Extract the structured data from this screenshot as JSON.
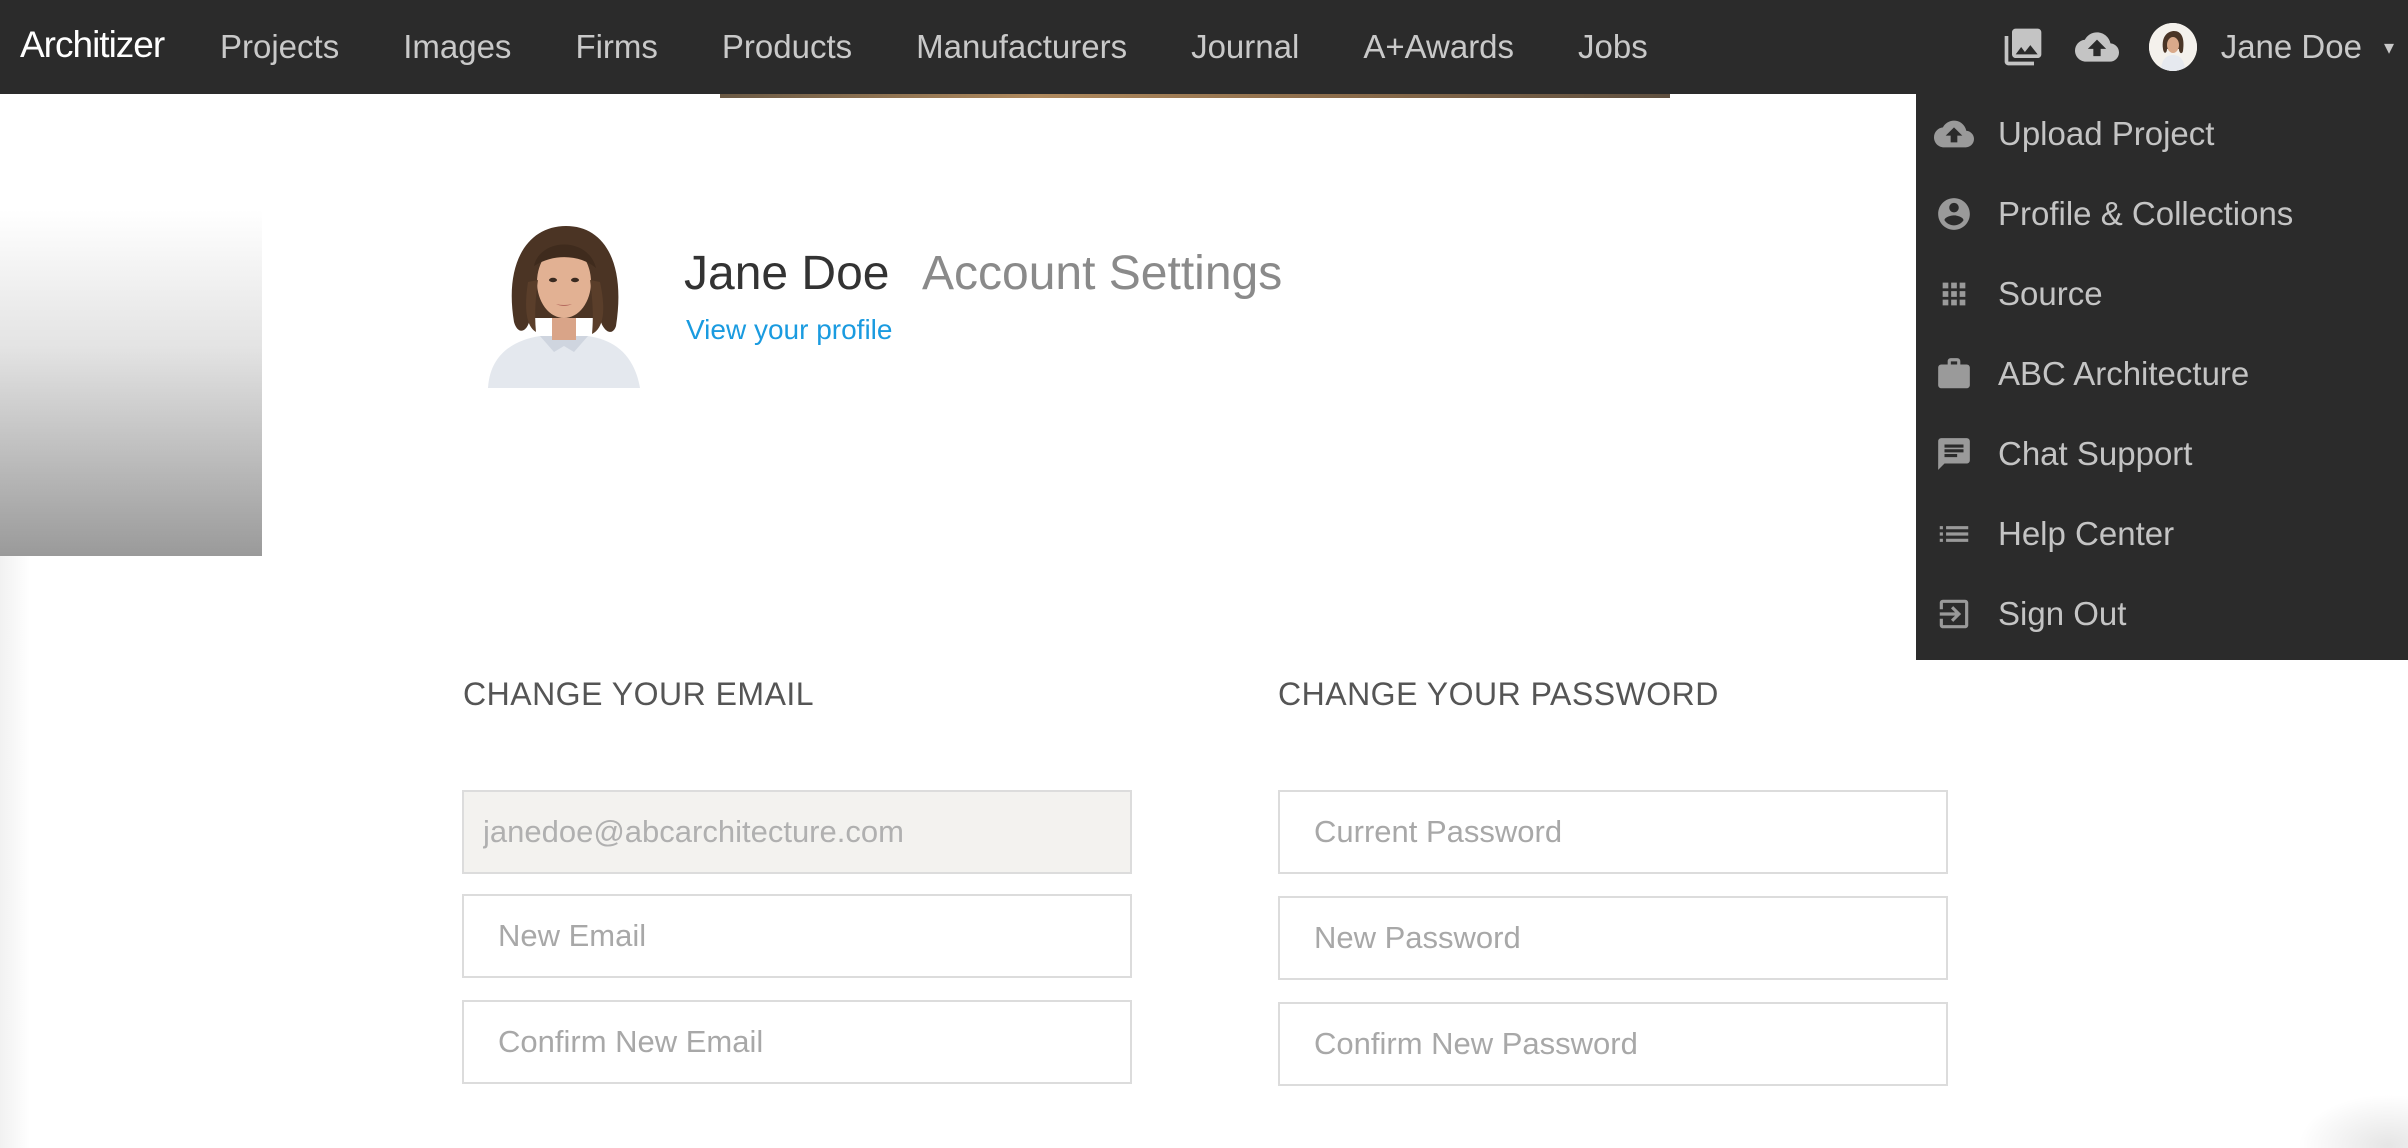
{
  "brand": {
    "logo_text": "Architizer"
  },
  "nav": {
    "items": [
      {
        "label": "Projects"
      },
      {
        "label": "Images"
      },
      {
        "label": "Firms"
      },
      {
        "label": "Products"
      },
      {
        "label": "Manufacturers"
      },
      {
        "label": "Journal"
      },
      {
        "label": "A+Awards"
      },
      {
        "label": "Jobs"
      }
    ]
  },
  "user": {
    "name": "Jane Doe",
    "caret": "▾"
  },
  "profile": {
    "name": "Jane Doe",
    "page_title": "Account Settings",
    "view_profile_link": "View your profile"
  },
  "email_section": {
    "heading": "CHANGE YOUR EMAIL",
    "current_email": "janedoe@abcarchitecture.com",
    "new_email_placeholder": "New Email",
    "confirm_email_placeholder": "Confirm New Email"
  },
  "password_section": {
    "heading": "CHANGE YOUR PASSWORD",
    "current_password_placeholder": "Current Password",
    "new_password_placeholder": "New Password",
    "confirm_password_placeholder": "Confirm New Password"
  },
  "user_menu": {
    "items": [
      {
        "label": "Upload Project",
        "icon": "cloud-upload-icon"
      },
      {
        "label": "Profile & Collections",
        "icon": "account-circle-icon"
      },
      {
        "label": "Source",
        "icon": "grid-icon"
      },
      {
        "label": "ABC Architecture",
        "icon": "briefcase-icon"
      },
      {
        "label": "Chat Support",
        "icon": "chat-icon"
      },
      {
        "label": "Help Center",
        "icon": "list-icon"
      },
      {
        "label": "Sign Out",
        "icon": "exit-icon"
      }
    ]
  },
  "colors": {
    "nav_bg": "#2b2b2b",
    "link": "#1a9be0",
    "disabled_field_bg": "#f3f2ef"
  }
}
